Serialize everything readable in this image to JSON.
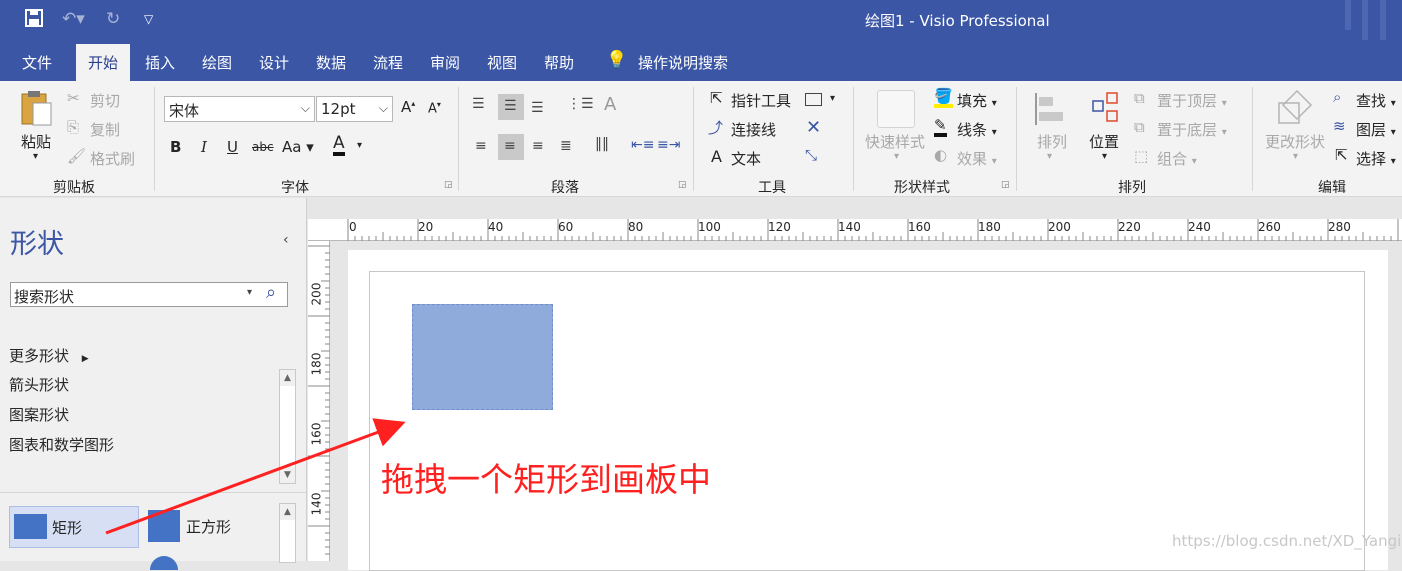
{
  "window": {
    "title": "绘图1  -  Visio Professional"
  },
  "quick_access": {
    "save": "save-icon",
    "undo": "undo-icon",
    "redo": "redo-icon",
    "customize": "customize-icon"
  },
  "tabs": [
    {
      "label": "文件"
    },
    {
      "label": "开始"
    },
    {
      "label": "插入"
    },
    {
      "label": "绘图"
    },
    {
      "label": "设计"
    },
    {
      "label": "数据"
    },
    {
      "label": "流程"
    },
    {
      "label": "审阅"
    },
    {
      "label": "视图"
    },
    {
      "label": "帮助"
    }
  ],
  "tell_me": "操作说明搜索",
  "ribbon": {
    "clipboard": {
      "paste": "粘贴",
      "cut": "剪切",
      "copy": "复制",
      "format_painter": "格式刷",
      "group": "剪贴板"
    },
    "font": {
      "name": "宋体",
      "size": "12pt",
      "bold": "B",
      "italic": "I",
      "underline": "U",
      "strike": "abc",
      "case": "Aa",
      "color": "A",
      "group": "字体"
    },
    "paragraph": {
      "group": "段落"
    },
    "tools": {
      "pointer": "指针工具",
      "connector": "连接线",
      "text": "文本",
      "text_letter": "A",
      "group": "工具"
    },
    "shape_styles": {
      "quick_styles": "快速样式",
      "fill": "填充",
      "line": "线条",
      "effects": "效果",
      "group": "形状样式"
    },
    "arrange": {
      "align": "排列",
      "position": "位置",
      "bring_front": "置于顶层",
      "send_back": "置于底层",
      "group_btn": "组合",
      "group": "排列"
    },
    "editing": {
      "change_shape": "更改形状",
      "find": "查找",
      "layers": "图层",
      "select": "选择",
      "group": "编辑"
    }
  },
  "shapes_panel": {
    "title": "形状",
    "search_value": "搜索形状",
    "items": [
      {
        "label": "更多形状"
      },
      {
        "label": "箭头形状"
      },
      {
        "label": "图案形状"
      },
      {
        "label": "图表和数学图形"
      }
    ],
    "stencils": [
      {
        "label": "矩形"
      },
      {
        "label": "正方形"
      }
    ]
  },
  "ruler": {
    "top": [
      "0",
      "20",
      "40",
      "60",
      "80",
      "100",
      "120",
      "140",
      "160",
      "180",
      "200",
      "220",
      "240",
      "260",
      "280"
    ],
    "left": [
      "200",
      "180",
      "160",
      "140"
    ]
  },
  "annotation": "拖拽一个矩形到画板中",
  "watermark": "https://blog.csdn.net/XD_Yangi",
  "colors": {
    "brand": "#3b56a5",
    "shape_fill": "#8eabdc",
    "annotation": "#ff2020"
  }
}
